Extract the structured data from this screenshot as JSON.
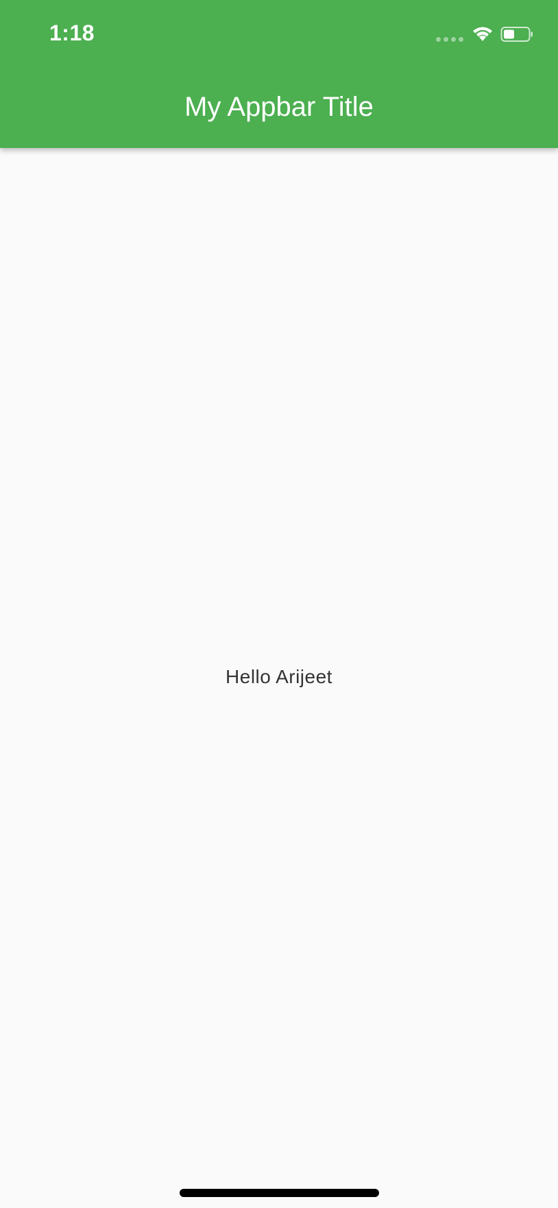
{
  "status_bar": {
    "time": "1:18",
    "icons": [
      "signal-dots-icon",
      "wifi-icon",
      "battery-icon"
    ]
  },
  "appbar": {
    "title": "My Appbar Title",
    "background_color": "#4caf50"
  },
  "body": {
    "text": "Hello Arijeet",
    "background_color": "#fafafa"
  },
  "home_indicator": {
    "color": "#000000"
  }
}
